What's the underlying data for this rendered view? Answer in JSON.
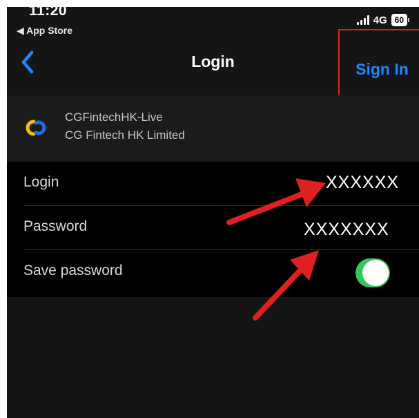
{
  "status_bar": {
    "time": "11:20",
    "back_app": "◀ App Store",
    "network": "4G",
    "battery": "60"
  },
  "nav": {
    "title": "Login",
    "sign_in_label": "Sign In"
  },
  "account": {
    "name": "CGFintechHK-Live",
    "company": "CG Fintech HK Limited"
  },
  "form": {
    "login_label": "Login",
    "login_value": "XXXXXX",
    "password_label": "Password",
    "password_value": "XXXXXXX",
    "save_password_label": "Save password",
    "save_password_on": true
  },
  "colors": {
    "accent": "#1e88ff",
    "toggle_on": "#34c759",
    "annotation": "#e02020"
  }
}
